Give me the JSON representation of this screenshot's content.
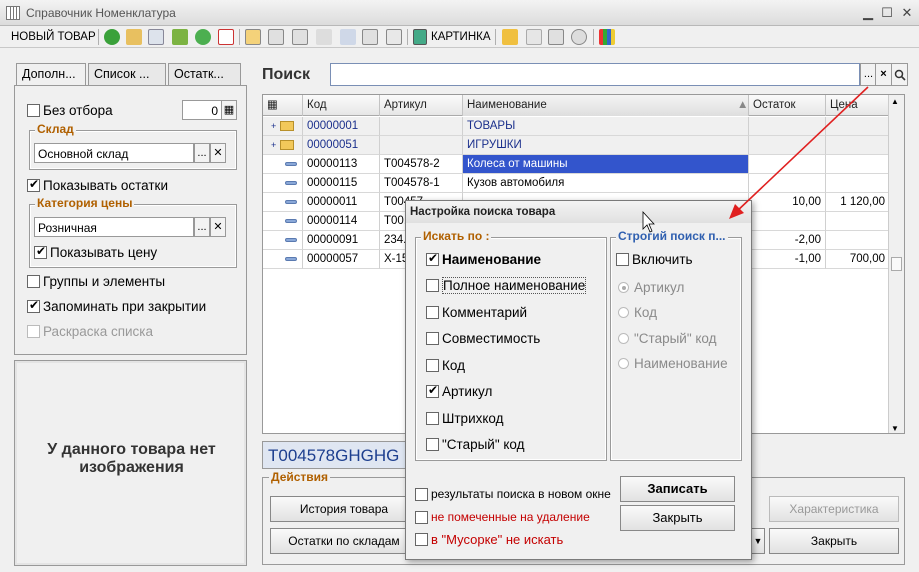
{
  "window": {
    "title": "Справочник Номенклатура"
  },
  "toolbar": {
    "new_item": "НОВЫЙ ТОВАР",
    "picture": "КАРТИНКА"
  },
  "tabs": [
    "Дополн...",
    "Список ...",
    "Остатк..."
  ],
  "left": {
    "no_filter": "Без отбора",
    "no_filter_value": "0",
    "warehouse_group": "Склад",
    "warehouse_value": "Основной склад",
    "show_stock": "Показывать остатки",
    "price_group": "Категория цены",
    "price_value": "Розничная",
    "show_price": "Показывать цену",
    "groups_and_items": "Группы и элементы",
    "remember_on_close": "Запоминать при закрытии",
    "list_coloring": "Раскраска списка",
    "no_image": "У данного товара нет изображения"
  },
  "search": {
    "label": "Поиск",
    "value": "",
    "clear_btn": "×",
    "dots_btn": "...",
    "go_btn": "🔍"
  },
  "grid": {
    "columns": [
      "Код",
      "Артикул",
      "Наименование",
      "Остаток",
      "Цена"
    ],
    "rows": [
      {
        "kind": "folder",
        "code": "00000001",
        "article": "",
        "name": "ТОВАРЫ",
        "stock": "",
        "price": ""
      },
      {
        "kind": "folder",
        "code": "00000051",
        "article": "",
        "name": "ИГРУШКИ",
        "stock": "",
        "price": ""
      },
      {
        "kind": "item",
        "code": "00000113",
        "article": "Т004578-2",
        "name": "Колеса от машины",
        "stock": "",
        "price": ""
      },
      {
        "kind": "item",
        "code": "00000115",
        "article": "Т004578-1",
        "name": "Кузов автомобиля",
        "stock": "",
        "price": ""
      },
      {
        "kind": "item",
        "code": "00000011",
        "article": "Т00457...",
        "name": "",
        "stock": "10,00",
        "price": "1 120,00"
      },
      {
        "kind": "item",
        "code": "00000114",
        "article": "Т00...",
        "name": "",
        "stock": "",
        "price": ""
      },
      {
        "kind": "item",
        "code": "00000091",
        "article": "234...",
        "name": "",
        "stock": "-2,00",
        "price": ""
      },
      {
        "kind": "item",
        "code": "00000057",
        "article": "Х-15...",
        "name": "",
        "stock": "-1,00",
        "price": "700,00"
      }
    ]
  },
  "code_field": "Т004578GHGHG",
  "actions": {
    "title": "Действия",
    "history": "История товара",
    "stock_by_warehouse": "Остатки по складам",
    "characteristics": "Характеристика",
    "close": "Закрыть"
  },
  "dialog": {
    "title": "Настройка поиска товара",
    "search_in_title": "Искать по :",
    "fields": [
      {
        "label": "Наименование",
        "checked": true,
        "bold": true
      },
      {
        "label": "Полное наименование",
        "checked": false
      },
      {
        "label": "Комментарий",
        "checked": false
      },
      {
        "label": "Совместимость",
        "checked": false
      },
      {
        "label": "Код",
        "checked": false
      },
      {
        "label": "Артикул",
        "checked": true
      },
      {
        "label": "Штрихкод",
        "checked": false
      },
      {
        "label": "\"Старый\" код",
        "checked": false
      }
    ],
    "strict_title": "Строгий поиск п...",
    "strict_enable": "Включить",
    "strict_options": [
      "Артикул",
      "Код",
      "\"Старый\" код",
      "Наименование"
    ],
    "opt_new_window": "результаты поиска в новом окне",
    "opt_not_marked": "не помеченные на удаление",
    "opt_trash": "в \"Мусорке\" не искать",
    "save_btn": "Записать",
    "close_btn": "Закрыть"
  },
  "colors": {
    "accent_title": "#b06000",
    "selection": "#3355cc",
    "arrow": "#e02020",
    "folder_text": "#1a2f8c"
  }
}
